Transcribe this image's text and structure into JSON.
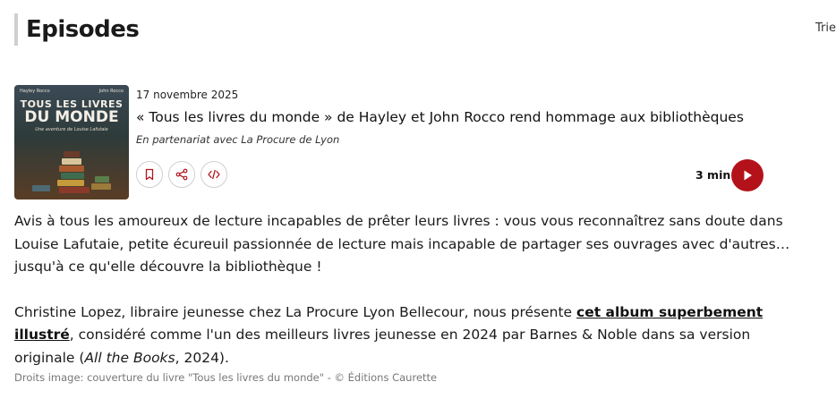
{
  "section": {
    "title": "Episodes",
    "sort_label": "Trie"
  },
  "episode": {
    "cover": {
      "author_left": "Hayley Rocco",
      "author_right": "John Rocco",
      "title_line1": "TOUS LES LIVRES",
      "title_line2": "DU MONDE",
      "subtitle": "Une aventure de Louise Lafutaie"
    },
    "date": "17 novembre 2025",
    "title": "« Tous les livres du monde » de Hayley et John Rocco rend hommage aux bibliothèques",
    "partner": "En partenariat avec La Procure de Lyon",
    "actions": {
      "bookmark_icon": "bookmark-icon",
      "share_icon": "share-icon",
      "embed_icon": "code-icon"
    },
    "duration": "3 min",
    "accent_color": "#b3121b"
  },
  "description": {
    "p1": "Avis à tous les amoureux de lecture incapables de prêter leurs livres : vous vous reconnaîtrez sans doute dans Louise Lafutaie, petite écureuil passionnée de lecture mais incapable de partager ses ouvrages avec d'autres… jusqu'à ce qu'elle découvre la bibliothèque !",
    "p2_before": "Christine Lopez, libraire jeunesse chez La Procure Lyon Bellecour, nous présente ",
    "p2_link": "cet album superbement illustré",
    "p2_middle": ", considéré comme l'un des meilleurs livres jeunesse en 2024 par Barnes & Noble dans sa version originale (",
    "p2_italic": "All the Books",
    "p2_after": ", 2024)."
  },
  "credit": "Droits image: couverture du livre \"Tous les livres du monde\" - © Éditions Caurette"
}
